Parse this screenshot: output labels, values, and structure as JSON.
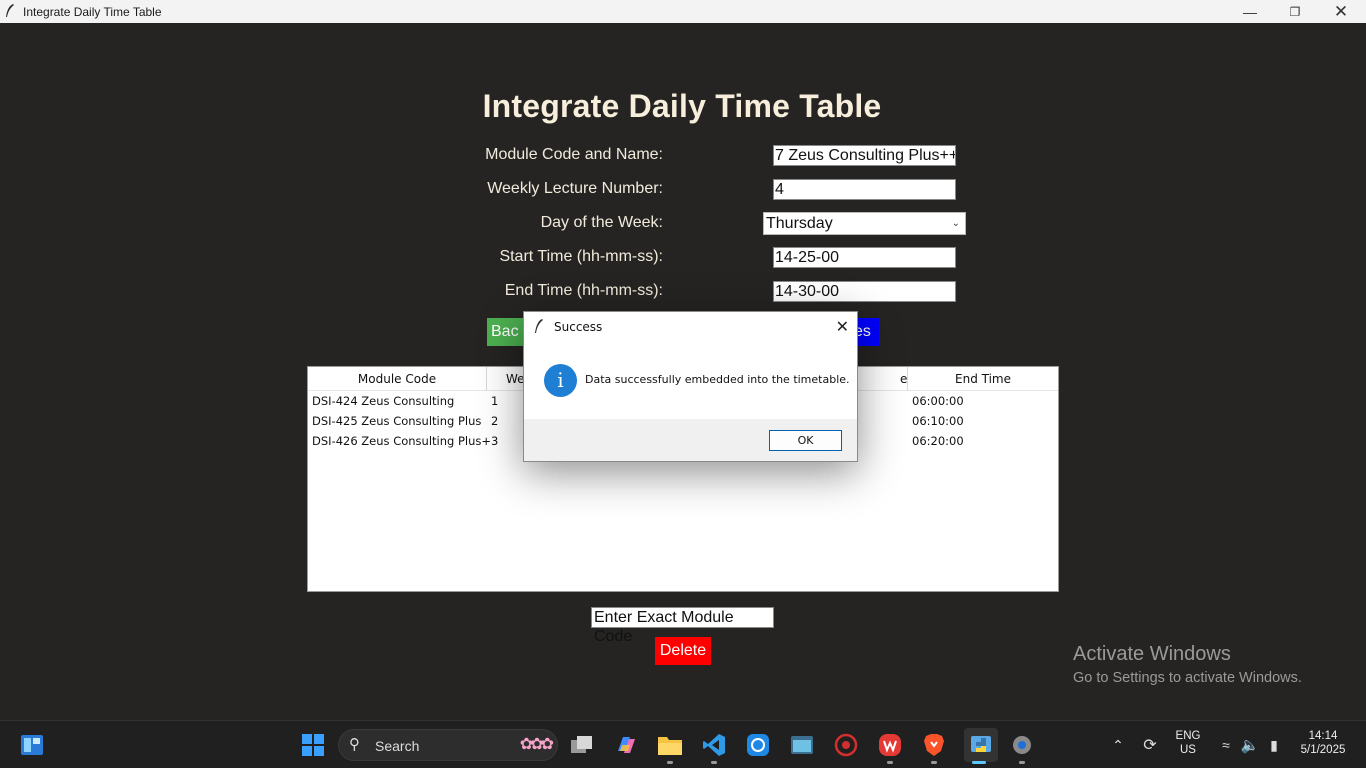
{
  "window": {
    "title": "Integrate Daily Time Table"
  },
  "header": {
    "title": "Integrate Daily Time Table"
  },
  "form": {
    "module_label": "Module Code and Name:",
    "module_value": "7 Zeus Consulting Plus++",
    "lecture_label": "Weekly Lecture Number:",
    "lecture_value": "4",
    "day_label": "Day of the Week:",
    "day_value": "Thursday",
    "start_label": "Start Time (hh-mm-ss):",
    "start_value": "14-25-00",
    "end_label": "End Time (hh-mm-ss):",
    "end_value": "14-30-00"
  },
  "buttons": {
    "back_partial": "Bac",
    "right_partial": "es"
  },
  "table": {
    "columns": [
      "Module Code",
      "We",
      "End Time"
    ],
    "rows": [
      {
        "module": "DSI-424 Zeus Consulting",
        "week": "1",
        "end": "06:00:00"
      },
      {
        "module": "DSI-425 Zeus Consulting Plus",
        "week": "2",
        "end": "06:10:00"
      },
      {
        "module": "DSI-426 Zeus Consulting Plus+",
        "week": "3",
        "end": "06:20:00"
      }
    ],
    "partial_header_right": "e"
  },
  "delete_section": {
    "entry_value": "Enter Exact Module Code",
    "delete_label": "Delete"
  },
  "dialog": {
    "title": "Success",
    "message": "Data successfully embedded into the timetable.",
    "ok_label": "OK",
    "icon": "info-icon"
  },
  "watermark": {
    "line1": "Activate Windows",
    "line2": "Go to Settings to activate Windows."
  },
  "taskbar": {
    "search_label": "Search",
    "lang_line1": "ENG",
    "lang_line2": "US",
    "time": "14:14",
    "date": "5/1/2025"
  },
  "colors": {
    "background": "#252423",
    "back_button": "#4caf50",
    "right_button": "#0000ff",
    "delete_button": "#ff0000"
  }
}
